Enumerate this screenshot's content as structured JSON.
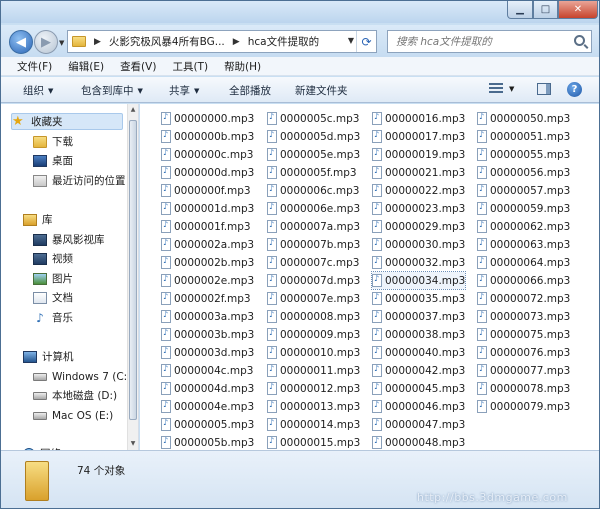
{
  "window": {
    "controls": {
      "minimize": "▁",
      "maximize": "□",
      "close": "✕"
    }
  },
  "address": {
    "crumbs": [
      "火影究极风暴4所有BG...",
      "hca文件提取的"
    ],
    "search_placeholder": "搜索 hca文件提取的"
  },
  "menu": [
    "文件(F)",
    "编辑(E)",
    "查看(V)",
    "工具(T)",
    "帮助(H)"
  ],
  "toolbar": {
    "organize": "组织",
    "include_in_library": "包含到库中",
    "share": "共享",
    "play_all": "全部播放",
    "new_folder": "新建文件夹"
  },
  "nav": {
    "favorites": "收藏夹",
    "downloads": "下载",
    "desktop": "桌面",
    "recent": "最近访问的位置",
    "libraries": "库",
    "baofeng": "暴风影视库",
    "videos": "视频",
    "pictures": "图片",
    "documents": "文档",
    "music": "音乐",
    "computer": "计算机",
    "drive_c": "Windows 7 (C:)",
    "drive_d": "本地磁盘 (D:)",
    "drive_e": "Mac OS (E:)",
    "network": "网络"
  },
  "files": {
    "col1": [
      "00000000.mp3",
      "0000000b.mp3",
      "0000000c.mp3",
      "0000000d.mp3",
      "0000000f.mp3",
      "0000001d.mp3",
      "0000001f.mp3",
      "0000002a.mp3",
      "0000002b.mp3",
      "0000002e.mp3",
      "0000002f.mp3",
      "0000003a.mp3",
      "0000003b.mp3",
      "0000003d.mp3",
      "0000004c.mp3",
      "0000004d.mp3",
      "0000004e.mp3",
      "00000005.mp3",
      "0000005b.mp3"
    ],
    "col2": [
      "0000005c.mp3",
      "0000005d.mp3",
      "0000005e.mp3",
      "0000005f.mp3",
      "0000006c.mp3",
      "0000006e.mp3",
      "0000007a.mp3",
      "0000007b.mp3",
      "0000007c.mp3",
      "0000007d.mp3",
      "0000007e.mp3",
      "00000008.mp3",
      "00000009.mp3",
      "00000010.mp3",
      "00000011.mp3",
      "00000012.mp3",
      "00000013.mp3",
      "00000014.mp3",
      "00000015.mp3"
    ],
    "col3": [
      "00000016.mp3",
      "00000017.mp3",
      "00000019.mp3",
      "00000021.mp3",
      "00000022.mp3",
      "00000023.mp3",
      "00000029.mp3",
      "00000030.mp3",
      "00000032.mp3",
      "00000034.mp3",
      "00000035.mp3",
      "00000037.mp3",
      "00000038.mp3",
      "00000040.mp3",
      "00000042.mp3",
      "00000045.mp3",
      "00000046.mp3",
      "00000047.mp3",
      "00000048.mp3"
    ],
    "col4": [
      "00000050.mp3",
      "00000051.mp3",
      "00000055.mp3",
      "00000056.mp3",
      "00000057.mp3",
      "00000059.mp3",
      "00000062.mp3",
      "00000063.mp3",
      "00000064.mp3",
      "00000066.mp3",
      "00000072.mp3",
      "00000073.mp3",
      "00000075.mp3",
      "00000076.mp3",
      "00000077.mp3",
      "00000078.mp3",
      "00000079.mp3"
    ]
  },
  "status": {
    "count": "74 个对象"
  },
  "watermark": "http://bbs.3dmgame.com"
}
